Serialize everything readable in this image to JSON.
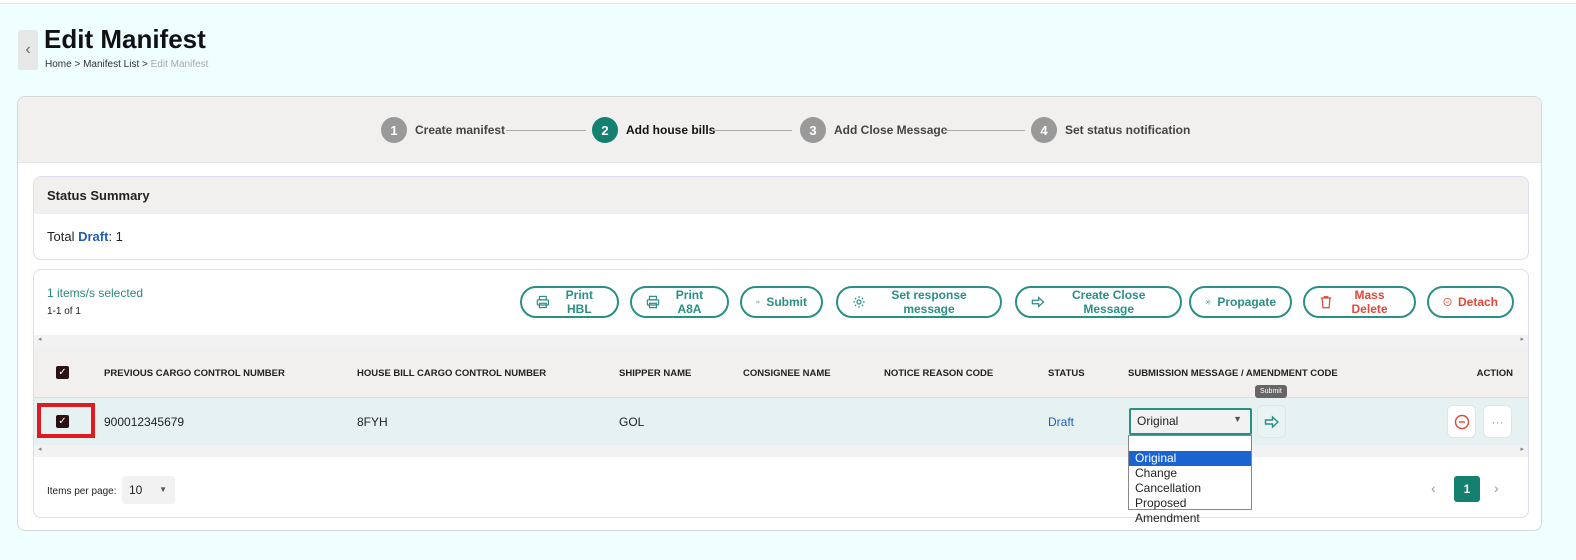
{
  "header": {
    "back_icon": "chevron-left-icon",
    "title": "Edit Manifest",
    "breadcrumb": [
      "Home",
      "Manifest List",
      "Edit Manifest"
    ]
  },
  "stepper": [
    {
      "num": "1",
      "label": "Create manifest"
    },
    {
      "num": "2",
      "label": "Add house bills",
      "active": true
    },
    {
      "num": "3",
      "label": "Add Close Message"
    },
    {
      "num": "4",
      "label": "Set status notification"
    }
  ],
  "summary": {
    "title": "Status Summary",
    "total_label": "Total",
    "status": "Draft",
    "count": ": 1"
  },
  "table": {
    "selected": "1 items/s selected",
    "range": "1-1 of 1",
    "buttons": [
      "Print HBL",
      "Print A8A",
      "Submit",
      "Set response message",
      "Create Close Message",
      "Propagate",
      "Mass Delete",
      "Detach"
    ],
    "columns": [
      "PREVIOUS CARGO CONTROL NUMBER",
      "HOUSE BILL CARGO CONTROL NUMBER",
      "SHIPPER NAME",
      "CONSIGNEE NAME",
      "NOTICE REASON CODE",
      "STATUS",
      "SUBMISSION MESSAGE / AMENDMENT CODE",
      "ACTION"
    ],
    "rows": [
      {
        "prev": "900012345679",
        "house": "8FYH",
        "shipper": "GOL",
        "consignee": "",
        "notice": "",
        "status": "Draft",
        "submission": "Original"
      }
    ],
    "submission_options": [
      "",
      "Original",
      "Change",
      "Cancellation",
      "Proposed Amendment"
    ],
    "tooltip": "Submit",
    "items_per_page_label": "Items per page:",
    "items_per_page": "10",
    "page": "1"
  },
  "colors": {
    "accent": "#14806f",
    "danger": "#e0483a",
    "link": "#1f5fb5"
  }
}
